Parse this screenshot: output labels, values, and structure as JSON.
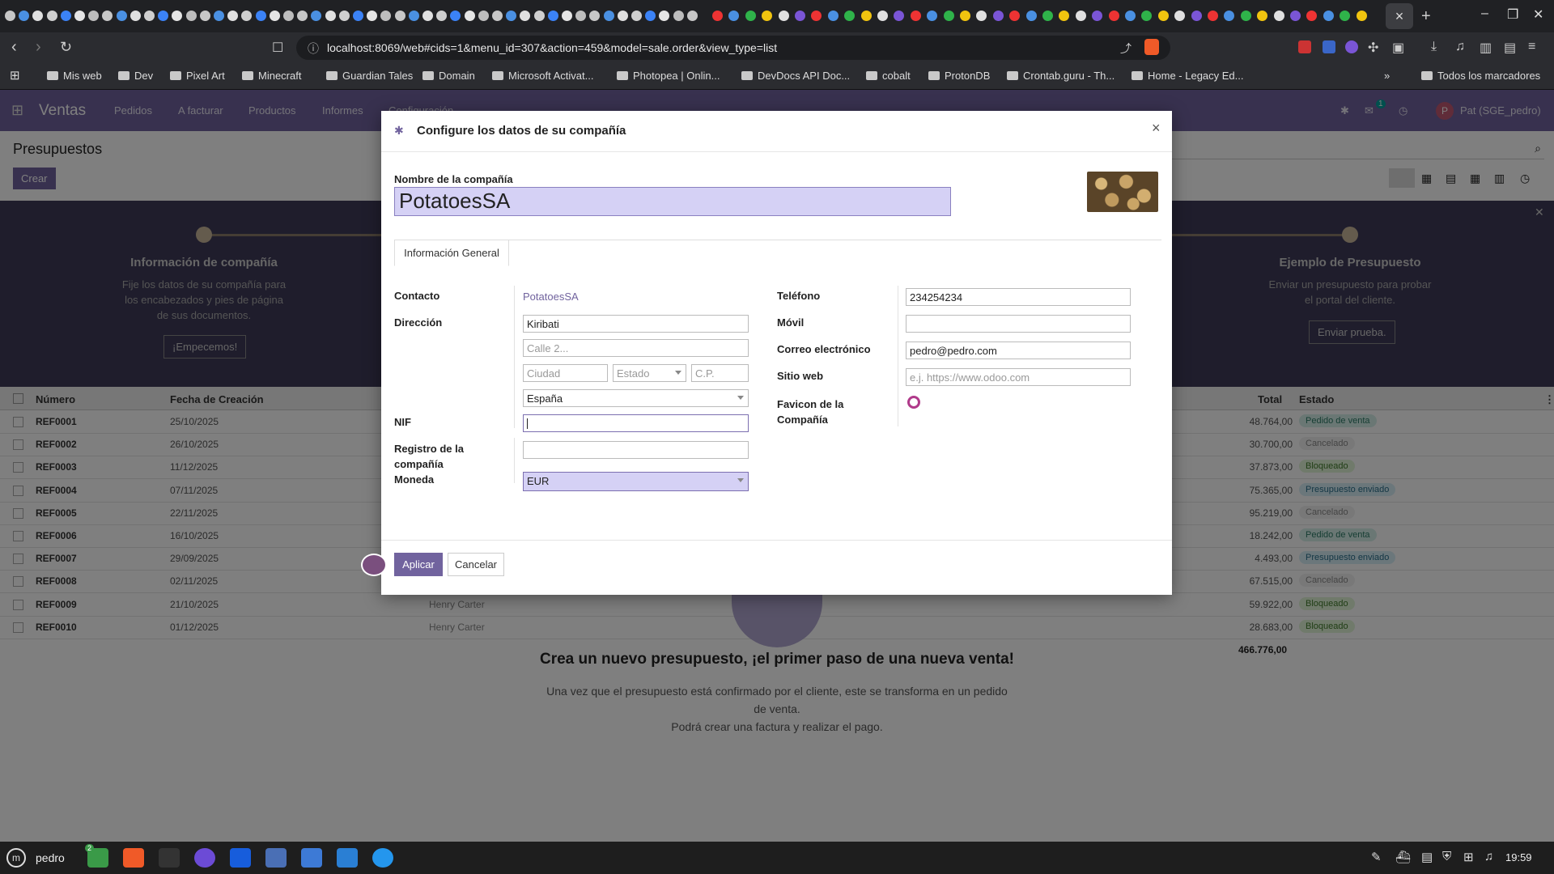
{
  "browser": {
    "url": "localhost:8069/web#cids=1&menu_id=307&action=459&model=sale.order&view_type=list",
    "bookmarks": [
      "Mis web",
      "Dev",
      "Pixel Art",
      "Minecraft",
      "Guardian Tales",
      "Domain",
      "Microsoft Activat...",
      "Photopea | Onlin...",
      "DevDocs API Doc...",
      "cobalt",
      "ProtonDB",
      "Crontab.guru - Th...",
      "Home - Legacy Ed..."
    ],
    "all_bookmarks": "Todos los marcadores",
    "more": "»"
  },
  "odoo": {
    "app": "Ventas",
    "menu": [
      "Pedidos",
      "A facturar",
      "Productos",
      "Informes",
      "Configuración"
    ],
    "user": "Pat (SGE_pedro)",
    "user_initial": "P",
    "breadcrumb": "Presupuestos",
    "create_button": "Crear",
    "chat_count": "1"
  },
  "banner": {
    "step1_title": "Información de compañía",
    "step1_text": [
      "Fije los datos de su compañía para",
      "los encabezados y pies de página",
      "de sus documentos."
    ],
    "step1_button": "¡Empecemos!",
    "step2_title": "Ejemplo de Presupuesto",
    "step2_text": [
      "Enviar un presupuesto para probar",
      "el portal del cliente."
    ],
    "step2_button": "Enviar prueba."
  },
  "list": {
    "headers": [
      "Número",
      "Fecha de Creación",
      "Total",
      "Estado"
    ],
    "rows": [
      {
        "num": "REF0001",
        "date": "25/10/2025",
        "total": "48.764,00",
        "state": "Pedido de venta"
      },
      {
        "num": "REF0002",
        "date": "26/10/2025",
        "total": "30.700,00",
        "state": "Cancelado"
      },
      {
        "num": "REF0003",
        "date": "11/12/2025",
        "total": "37.873,00",
        "state": "Bloqueado"
      },
      {
        "num": "REF0004",
        "date": "07/11/2025",
        "total": "75.365,00",
        "state": "Presupuesto enviado"
      },
      {
        "num": "REF0005",
        "date": "22/11/2025",
        "total": "95.219,00",
        "state": "Cancelado"
      },
      {
        "num": "REF0006",
        "date": "16/10/2025",
        "total": "18.242,00",
        "state": "Pedido de venta"
      },
      {
        "num": "REF0007",
        "date": "29/09/2025",
        "total": "4.493,00",
        "state": "Presupuesto enviado"
      },
      {
        "num": "REF0008",
        "date": "02/11/2025",
        "total": "67.515,00",
        "state": "Cancelado"
      },
      {
        "num": "REF0009",
        "date": "21/10/2025",
        "total": "59.922,00",
        "state": "Bloqueado"
      },
      {
        "num": "REF0010",
        "date": "01/12/2025",
        "total": "28.683,00",
        "state": "Bloqueado"
      }
    ],
    "sum": "466.776,00",
    "salesperson": "Henry Carter"
  },
  "empty_help": {
    "title": "Crea un nuevo presupuesto, ¡el primer paso de una nueva venta!",
    "line1": "Una vez que el presupuesto está confirmado por el cliente, este se transforma en un pedido",
    "line2": "de venta.",
    "line3": "Podrá crear una factura y realizar el pago."
  },
  "modal": {
    "title": "Configure los datos de su compañía",
    "close": "×",
    "company_label": "Nombre de la compañía",
    "company_name": "PotatoesSA",
    "tab": "Información General",
    "contact_label": "Contacto",
    "contact_value": "PotatoesSA",
    "address_label": "Dirección",
    "street": "Kiribati",
    "street2_ph": "Calle 2...",
    "city_ph": "Ciudad",
    "state_ph": "Estado",
    "zip_ph": "C.P.",
    "country": "España",
    "vat_label": "NIF",
    "registry_label_1": "Registro de la",
    "registry_label_2": "compañía",
    "currency_label": "Moneda",
    "currency": "EUR",
    "phone_label": "Teléfono",
    "phone": "234254234",
    "mobile_label": "Móvil",
    "email_label": "Correo electrónico",
    "email": "pedro@pedro.com",
    "website_label": "Sitio web",
    "website_ph": "e.j. https://www.odoo.com",
    "favicon_label_1": "Favicon de la",
    "favicon_label_2": "Compañía",
    "apply": "Aplicar",
    "cancel": "Cancelar"
  },
  "taskbar": {
    "user": "pedro",
    "time": "19:59",
    "files_badge": "2"
  },
  "colors": {
    "odoo_primary": "#71639e",
    "banner": "#3e3a58",
    "highlight_input": "#d5d1f5"
  }
}
